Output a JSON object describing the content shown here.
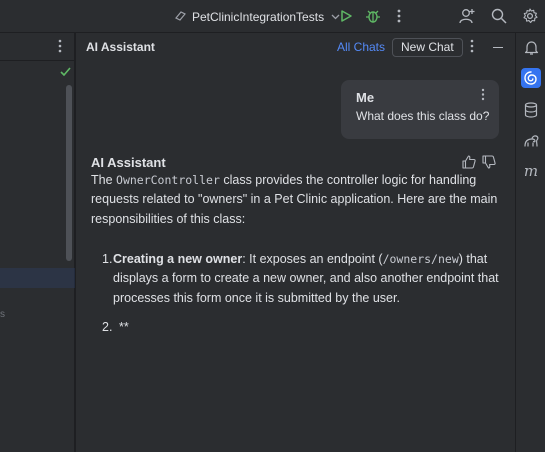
{
  "toolbar": {
    "run_config": "PetClinicIntegrationTests",
    "icons": [
      "run-config-icon",
      "chevron-down-icon",
      "run-icon",
      "debug-icon",
      "more-icon",
      "add-user-icon",
      "search-icon",
      "settings-icon"
    ]
  },
  "left_panel": {
    "fragment": "s"
  },
  "chat": {
    "title": "AI Assistant",
    "all_chats_label": "All Chats",
    "new_chat_label": "New Chat",
    "user_message": {
      "author": "Me",
      "text": "What does this class do?"
    },
    "assistant": {
      "author": "AI Assistant",
      "intro_before": "The ",
      "intro_code": "OwnerController",
      "intro_after": " class provides the controller logic for handling requests related to \"owners\" in a Pet Clinic application. Here are the main responsibilities of this class:",
      "items": [
        {
          "number": "1.",
          "bold": "Creating a new owner",
          "text_before": ": It exposes an endpoint (",
          "code": "/owners/new",
          "text_after": ") that displays a form to create a new owner, and also another endpoint that processes this form once it is submitted by the user."
        },
        {
          "number": "2.",
          "text": "**"
        }
      ]
    }
  },
  "right_bar": {
    "icons": [
      "notifications-icon",
      "ai-assistant-icon",
      "database-icon",
      "gradle-icon",
      "m-icon"
    ],
    "m_label": "m"
  },
  "colors": {
    "accent": "#3574f0",
    "link": "#548af7",
    "run_green": "#5fb865",
    "background": "#2b2d30"
  }
}
